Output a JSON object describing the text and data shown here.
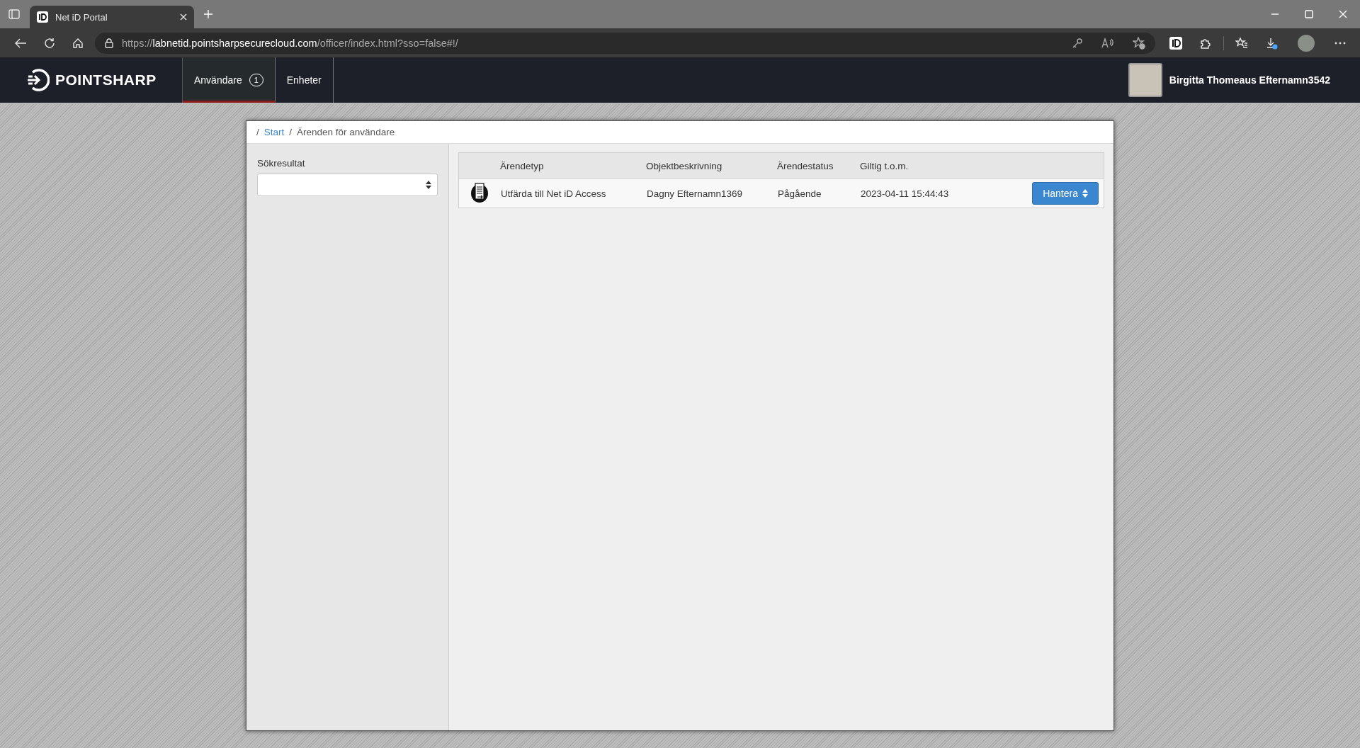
{
  "browser": {
    "tab_title": "Net iD Portal",
    "url_scheme": "https://",
    "url_host": "labnetid.pointsharpsecurecloud.com",
    "url_path": "/officer/index.html?sso=false#!/"
  },
  "nav": {
    "brand": "POINTSHARP",
    "tabs": [
      {
        "label": "Användare",
        "badge": "1",
        "selected": true
      },
      {
        "label": "Enheter",
        "selected": false
      }
    ],
    "user_name": "Birgitta Thomeaus Efternamn3542"
  },
  "breadcrumb": {
    "separator": "/",
    "items": [
      {
        "label": "Start",
        "link": true
      },
      {
        "label": "Ärenden för användare",
        "link": false
      }
    ]
  },
  "filter": {
    "label": "Sökresultat"
  },
  "table": {
    "columns": [
      "Ärendetyp",
      "Objektbeskrivning",
      "Ärendestatus",
      "Giltig t.o.m."
    ],
    "rows": [
      {
        "cells": [
          "Utfärda till Net iD Access",
          "Dagny Efternamn1369",
          "Pågående",
          "2023-04-11 15:44:43"
        ],
        "action": "Hantera"
      }
    ]
  }
}
